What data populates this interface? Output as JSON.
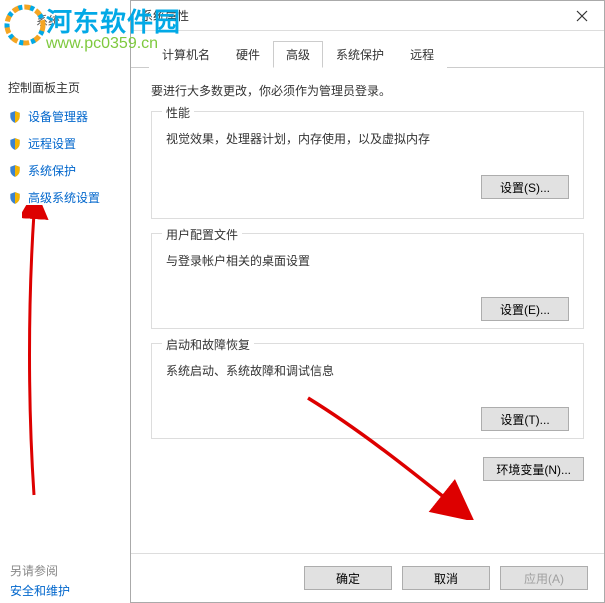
{
  "sidebar": {
    "system_label": "系统",
    "cp_home": "控制面板主页",
    "links": [
      {
        "label": "设备管理器"
      },
      {
        "label": "远程设置"
      },
      {
        "label": "系统保护"
      },
      {
        "label": "高级系统设置"
      }
    ],
    "see_also": "另请参阅",
    "security": "安全和维护"
  },
  "dialog": {
    "title": "系统属性",
    "close": "×",
    "tabs": [
      "计算机名",
      "硬件",
      "高级",
      "系统保护",
      "远程"
    ],
    "active_tab": 2,
    "admin_note": "要进行大多数更改，你必须作为管理员登录。",
    "groups": {
      "perf": {
        "title": "性能",
        "desc": "视觉效果，处理器计划，内存使用，以及虚拟内存",
        "btn": "设置(S)..."
      },
      "profile": {
        "title": "用户配置文件",
        "desc": "与登录帐户相关的桌面设置",
        "btn": "设置(E)..."
      },
      "startup": {
        "title": "启动和故障恢复",
        "desc": "系统启动、系统故障和调试信息",
        "btn": "设置(T)..."
      }
    },
    "env_btn": "环境变量(N)...",
    "footer": {
      "ok": "确定",
      "cancel": "取消",
      "apply": "应用(A)"
    }
  },
  "watermark": {
    "cn": "河东软件园",
    "url": "www.pc0359.cn"
  }
}
